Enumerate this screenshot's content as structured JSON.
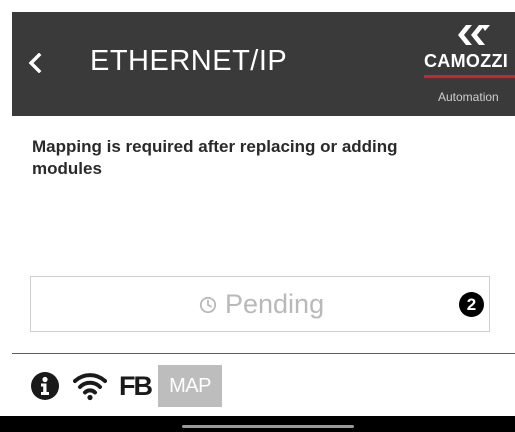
{
  "header": {
    "title": "ETHERNET/IP",
    "back_icon": "chevron-left-icon"
  },
  "brand": {
    "name": "CAMOZZI",
    "subtitle": "Automation",
    "accent_color": "#d0202a"
  },
  "message": {
    "text": "Mapping is required after replacing or adding modules"
  },
  "status": {
    "icon": "clock-icon",
    "label": "Pending",
    "step_number": "2"
  },
  "toolbar": {
    "info_icon": "info-icon",
    "wifi_icon": "wifi-icon",
    "fb_label": "FB",
    "map_label": "MAP"
  },
  "colors": {
    "header_bg": "#3a3a3a",
    "divider": "#c8323a",
    "map_button_bg": "#bdbdbd",
    "status_text": "#b9b9b9"
  }
}
